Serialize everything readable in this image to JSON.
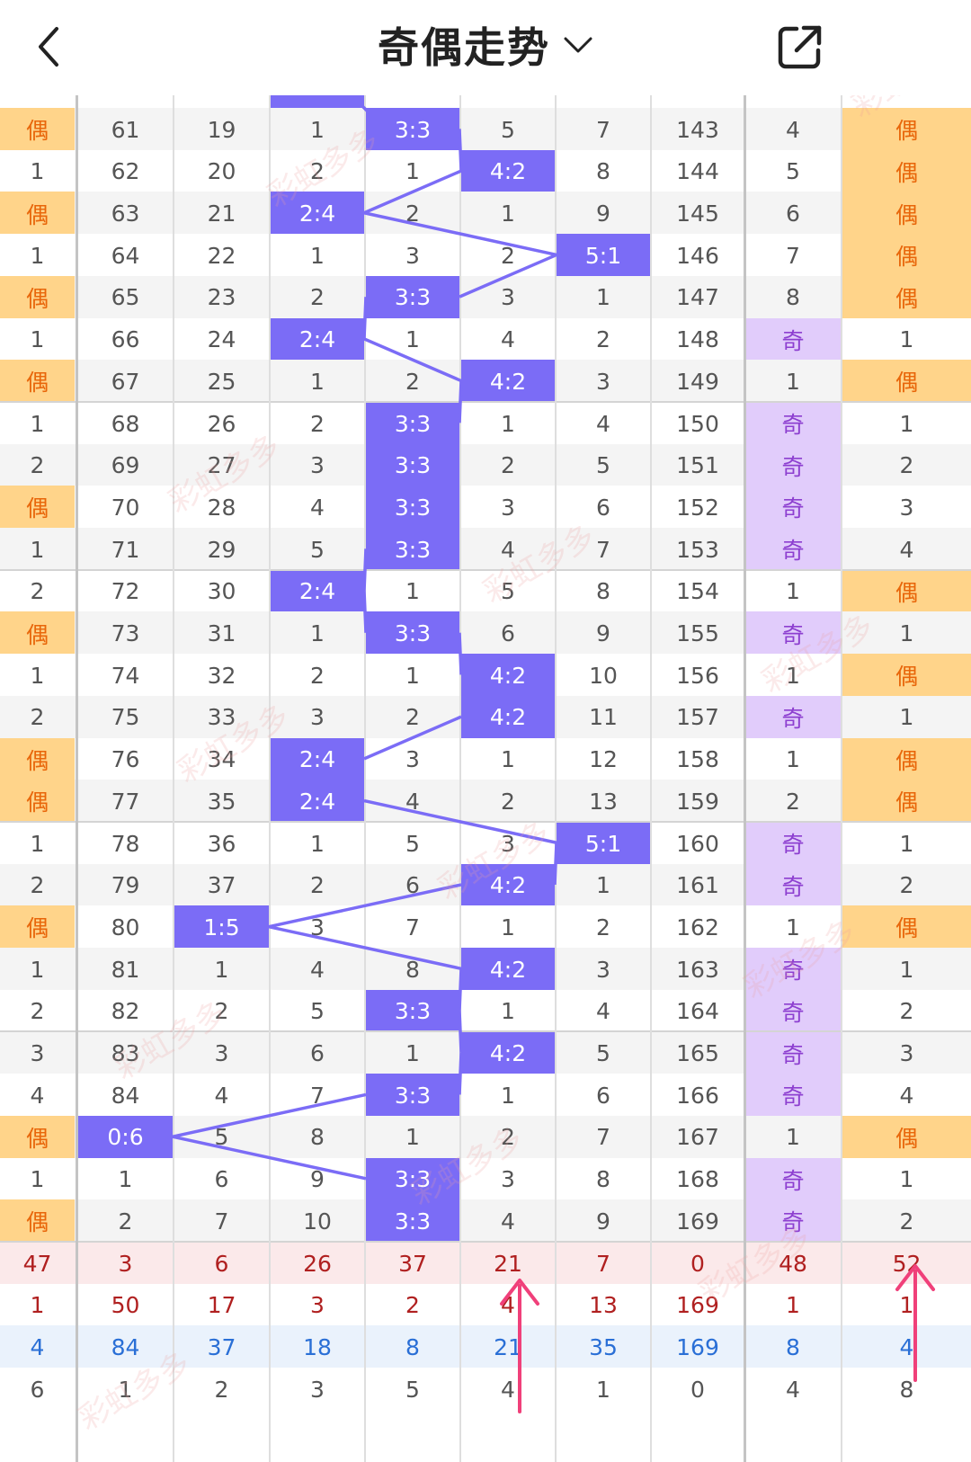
{
  "header": {
    "title": "奇偶走势",
    "back_icon": "back-arrow-icon",
    "dropdown_icon": "chevron-down-icon",
    "share_icon": "share-icon"
  },
  "colors": {
    "ratio_bg": "#7b6cf6",
    "even_bg": "#ffd48a",
    "even_text": "#e8660a",
    "odd_bg": "#e1ccfb",
    "odd_text": "#8d3fd0",
    "stat_red": "#b02020",
    "stat_blue": "#2a6fd6",
    "arrow": "#f0407a"
  },
  "watermark": "彩虹多多",
  "rows": [
    [
      "偶",
      "61",
      "19",
      "1",
      "3:3",
      "5",
      "7",
      "143",
      "4",
      "偶"
    ],
    [
      "1",
      "62",
      "20",
      "2",
      "1",
      "4:2",
      "8",
      "144",
      "5",
      "偶"
    ],
    [
      "偶",
      "63",
      "21",
      "2:4",
      "2",
      "1",
      "9",
      "145",
      "6",
      "偶"
    ],
    [
      "1",
      "64",
      "22",
      "1",
      "3",
      "2",
      "5:1",
      "146",
      "7",
      "偶"
    ],
    [
      "偶",
      "65",
      "23",
      "2",
      "3:3",
      "3",
      "1",
      "147",
      "8",
      "偶"
    ],
    [
      "1",
      "66",
      "24",
      "2:4",
      "1",
      "4",
      "2",
      "148",
      "奇",
      "1"
    ],
    [
      "偶",
      "67",
      "25",
      "1",
      "2",
      "4:2",
      "3",
      "149",
      "1",
      "偶"
    ],
    [
      "1",
      "68",
      "26",
      "2",
      "3:3",
      "1",
      "4",
      "150",
      "奇",
      "1"
    ],
    [
      "2",
      "69",
      "27",
      "3",
      "3:3",
      "2",
      "5",
      "151",
      "奇",
      "2"
    ],
    [
      "偶",
      "70",
      "28",
      "4",
      "3:3",
      "3",
      "6",
      "152",
      "奇",
      "3"
    ],
    [
      "1",
      "71",
      "29",
      "5",
      "3:3",
      "4",
      "7",
      "153",
      "奇",
      "4"
    ],
    [
      "2",
      "72",
      "30",
      "2:4",
      "1",
      "5",
      "8",
      "154",
      "1",
      "偶"
    ],
    [
      "偶",
      "73",
      "31",
      "1",
      "3:3",
      "6",
      "9",
      "155",
      "奇",
      "1"
    ],
    [
      "1",
      "74",
      "32",
      "2",
      "1",
      "4:2",
      "10",
      "156",
      "1",
      "偶"
    ],
    [
      "2",
      "75",
      "33",
      "3",
      "2",
      "4:2",
      "11",
      "157",
      "奇",
      "1"
    ],
    [
      "偶",
      "76",
      "34",
      "2:4",
      "3",
      "1",
      "12",
      "158",
      "1",
      "偶"
    ],
    [
      "偶",
      "77",
      "35",
      "2:4",
      "4",
      "2",
      "13",
      "159",
      "2",
      "偶"
    ],
    [
      "1",
      "78",
      "36",
      "1",
      "5",
      "3",
      "5:1",
      "160",
      "奇",
      "1"
    ],
    [
      "2",
      "79",
      "37",
      "2",
      "6",
      "4:2",
      "1",
      "161",
      "奇",
      "2"
    ],
    [
      "偶",
      "80",
      "1:5",
      "3",
      "7",
      "1",
      "2",
      "162",
      "1",
      "偶"
    ],
    [
      "1",
      "81",
      "1",
      "4",
      "8",
      "4:2",
      "3",
      "163",
      "奇",
      "1"
    ],
    [
      "2",
      "82",
      "2",
      "5",
      "3:3",
      "1",
      "4",
      "164",
      "奇",
      "2"
    ],
    [
      "3",
      "83",
      "3",
      "6",
      "1",
      "4:2",
      "5",
      "165",
      "奇",
      "3"
    ],
    [
      "4",
      "84",
      "4",
      "7",
      "3:3",
      "1",
      "6",
      "166",
      "奇",
      "4"
    ],
    [
      "偶",
      "0:6",
      "5",
      "8",
      "1",
      "2",
      "7",
      "167",
      "1",
      "偶"
    ],
    [
      "1",
      "1",
      "6",
      "9",
      "3:3",
      "3",
      "8",
      "168",
      "奇",
      "1"
    ],
    [
      "偶",
      "2",
      "7",
      "10",
      "3:3",
      "4",
      "9",
      "169",
      "奇",
      "2"
    ]
  ],
  "stats": [
    {
      "color": "red",
      "values": [
        "47",
        "3",
        "6",
        "26",
        "37",
        "21",
        "7",
        "0",
        "48",
        "52"
      ]
    },
    {
      "color": "red",
      "values": [
        "1",
        "50",
        "17",
        "3",
        "2",
        "4",
        "13",
        "169",
        "1",
        "1"
      ]
    },
    {
      "color": "blue",
      "values": [
        "4",
        "84",
        "37",
        "18",
        "8",
        "21",
        "35",
        "169",
        "8",
        "4"
      ]
    },
    {
      "color": "gray",
      "values": [
        "6",
        "1",
        "2",
        "3",
        "5",
        "4",
        "1",
        "0",
        "4",
        "8"
      ]
    }
  ]
}
